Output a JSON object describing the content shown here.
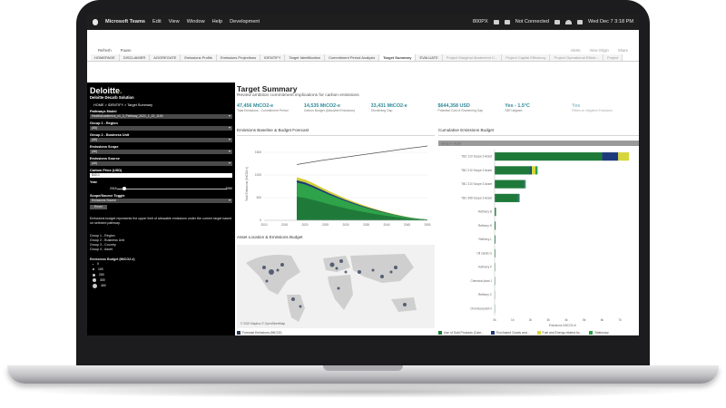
{
  "menubar": {
    "app": "Microsoft Teams",
    "items": [
      "Edit",
      "View",
      "Window",
      "Help",
      "Development"
    ],
    "right": [
      "800PX",
      "Not Connected",
      "Wed Dec 7  3:18 PM"
    ]
  },
  "toolbar": {
    "left": [
      "Refresh",
      "Pause"
    ],
    "right": [
      "Alerts",
      "View Origin",
      "Share"
    ]
  },
  "tabs": [
    {
      "label": "HOMEPAGE",
      "state": "normal"
    },
    {
      "label": "DISCLAIMER",
      "state": "normal"
    },
    {
      "label": "AGGREGATE",
      "state": "normal"
    },
    {
      "label": "Emissions Profile",
      "state": "normal"
    },
    {
      "label": "Emissions Projections",
      "state": "normal"
    },
    {
      "label": "IDENTIFY",
      "state": "normal"
    },
    {
      "label": "Target Identification",
      "state": "normal"
    },
    {
      "label": "Commitment Period Analysis",
      "state": "normal"
    },
    {
      "label": "Target Summary",
      "state": "active"
    },
    {
      "label": "EVALUATE",
      "state": "normal"
    },
    {
      "label": "Project Marginal Abatement C...",
      "state": "muted"
    },
    {
      "label": "Project Capital Efficiency",
      "state": "muted"
    },
    {
      "label": "Project Operational Efficie...",
      "state": "muted"
    },
    {
      "label": "Project",
      "state": "muted"
    }
  ],
  "sidebar": {
    "logo": "Deloitte",
    "subtitle": "Deloitte Decarb Solution",
    "breadcrumb": "HOME     >  IDENTIFY  >  Target Summary",
    "fields": {
      "pathway_label": "Pathways Model",
      "pathway_value": "HealthAcademics_v1_3_Pathway_2021_1_22_1100",
      "group1_label": "Group 1 - Region",
      "group1_value": "(All)",
      "group2_label": "Group 2 - Business Unit",
      "group2_value": "(All)",
      "scope_label": "Emissions Scope",
      "scope_value": "(All)",
      "source_label": "Emissions Source",
      "source_value": "(All)",
      "carbon_label": "Carbon Price (USD)",
      "carbon_value": "$40.0",
      "year_label": "Year",
      "year_start": "2018",
      "year_end": "2050",
      "toggle_label": "Scope/Source Toggle",
      "toggle_value": "Emissions Source",
      "reset": "Reset"
    },
    "note": "Emissions budget represents the upper limit of allowable emissions under the current target based on selected pathway.",
    "groups": [
      "Group 1 - Region",
      "Group 2 - Business Unit",
      "Group 3 - Country",
      "Group 4 - Asset"
    ],
    "bubble_legend_title": "Emissions Budget (MtCO2-e)",
    "bubble_legend": [
      "0",
      "100",
      "200",
      "300",
      "400"
    ]
  },
  "main": {
    "title": "Target Summary",
    "subtitle": "Review ambition commitment implications for carbon emissions",
    "kpis": [
      {
        "value": "47,456 MtCO2-e",
        "desc": "Total Emissions - Commitment Period",
        "faded": false
      },
      {
        "value": "14,535 MtCO2-e",
        "desc": "Carbon Budget (Allocable Emissions)",
        "faded": false
      },
      {
        "value": "33,431 MtCO2-e",
        "desc": "Shortening Gap",
        "faded": false
      },
      {
        "value": "$644,358 USD",
        "desc": "Potential Cost of Shortening Gap",
        "faded": false
      },
      {
        "value": "Yes - 1.5°C",
        "desc": "SBTi aligned",
        "faded": false
      },
      {
        "value": "Yes",
        "desc": "Relies on Negative Emissions",
        "faded": true
      }
    ],
    "forecast_title": "Emissions Baseline & Budget Forecast",
    "forecast_ylabel": "Total Emissions (MtCO2-e)",
    "map_title": "Asset Location & Emissions Budget",
    "map_credit": "© 2022 Mapbox  © OpenStreetMap",
    "map_legend": "Forecast Emissions (MtCO2)",
    "cumul_title": "Cumulative Emissions Budget",
    "cumul_header": "Group 4 - Asset",
    "cumul_xlabel": "Emissions (MtCO2-e)",
    "cumul_legend": [
      {
        "label": "Use of Sold Products (Cate...",
        "color": "#1f7a3a"
      },
      {
        "label": "Purchased Goods and...",
        "color": "#1f3a7a"
      },
      {
        "label": "Fuel and Energy-related Ac...",
        "color": "#d6d63a"
      },
      {
        "label": "Stationary",
        "color": "#2ea34a"
      }
    ]
  },
  "chart_data": [
    {
      "type": "area",
      "title": "Emissions Baseline & Budget Forecast",
      "xlabel": "",
      "ylabel": "Total Emissions (MtCO2-e)",
      "x": [
        2018,
        2020,
        2022,
        2024,
        2026,
        2028,
        2030,
        2032,
        2034,
        2036,
        2038,
        2040,
        2042,
        2044,
        2046,
        2048,
        2050
      ],
      "xticks": [
        2010,
        2015,
        2020,
        2025,
        2030,
        2035,
        2040,
        2045,
        2050
      ],
      "yticks": [
        0,
        500,
        1000,
        1500
      ],
      "ylim": [
        0,
        1600
      ],
      "baseline_line": [
        1230,
        1260,
        1290,
        1320,
        1345,
        1370,
        1395,
        1420,
        1445,
        1470,
        1495,
        1520,
        1545,
        1570,
        1595,
        1615,
        1640
      ],
      "budget_area": [
        950,
        900,
        820,
        730,
        640,
        560,
        480,
        410,
        345,
        285,
        230,
        180,
        135,
        95,
        60,
        35,
        20
      ]
    },
    {
      "type": "bar",
      "title": "Cumulative Emissions Budget",
      "orientation": "horizontal",
      "xlabel": "Emissions (MtCO2-e)",
      "categories": [
        "TBC 110 Scope 3 Asset",
        "TBC 210 Scope 3 Asset",
        "TBC 310 Scope 3 Asset",
        "TBC 398 Scope 3 Asset",
        "Refinery B",
        "Refinery H",
        "Refinery L",
        "Oil sands G",
        "Refinery F",
        "Chemical plant J",
        "Refinery C",
        "Chemical plant 0"
      ],
      "xticks": [
        "0k",
        "1k",
        "2k",
        "3k",
        "4k",
        "5k",
        "6k",
        "7k"
      ],
      "xlim": [
        0,
        7600
      ],
      "series": [
        {
          "name": "Use of Sold Products (Cate...",
          "values": [
            6000,
            2000,
            1600,
            1300,
            80,
            60,
            50,
            40,
            30,
            30,
            20,
            20
          ]
        },
        {
          "name": "Purchased Goods and...",
          "values": [
            900,
            80,
            60,
            40,
            0,
            0,
            0,
            0,
            0,
            0,
            0,
            0
          ]
        },
        {
          "name": "Fuel and Energy-related Ac...",
          "values": [
            600,
            200,
            0,
            0,
            0,
            0,
            0,
            0,
            0,
            0,
            0,
            0
          ]
        },
        {
          "name": "Stationary",
          "values": [
            0,
            120,
            80,
            60,
            0,
            0,
            0,
            0,
            0,
            0,
            0,
            0
          ]
        }
      ]
    }
  ]
}
